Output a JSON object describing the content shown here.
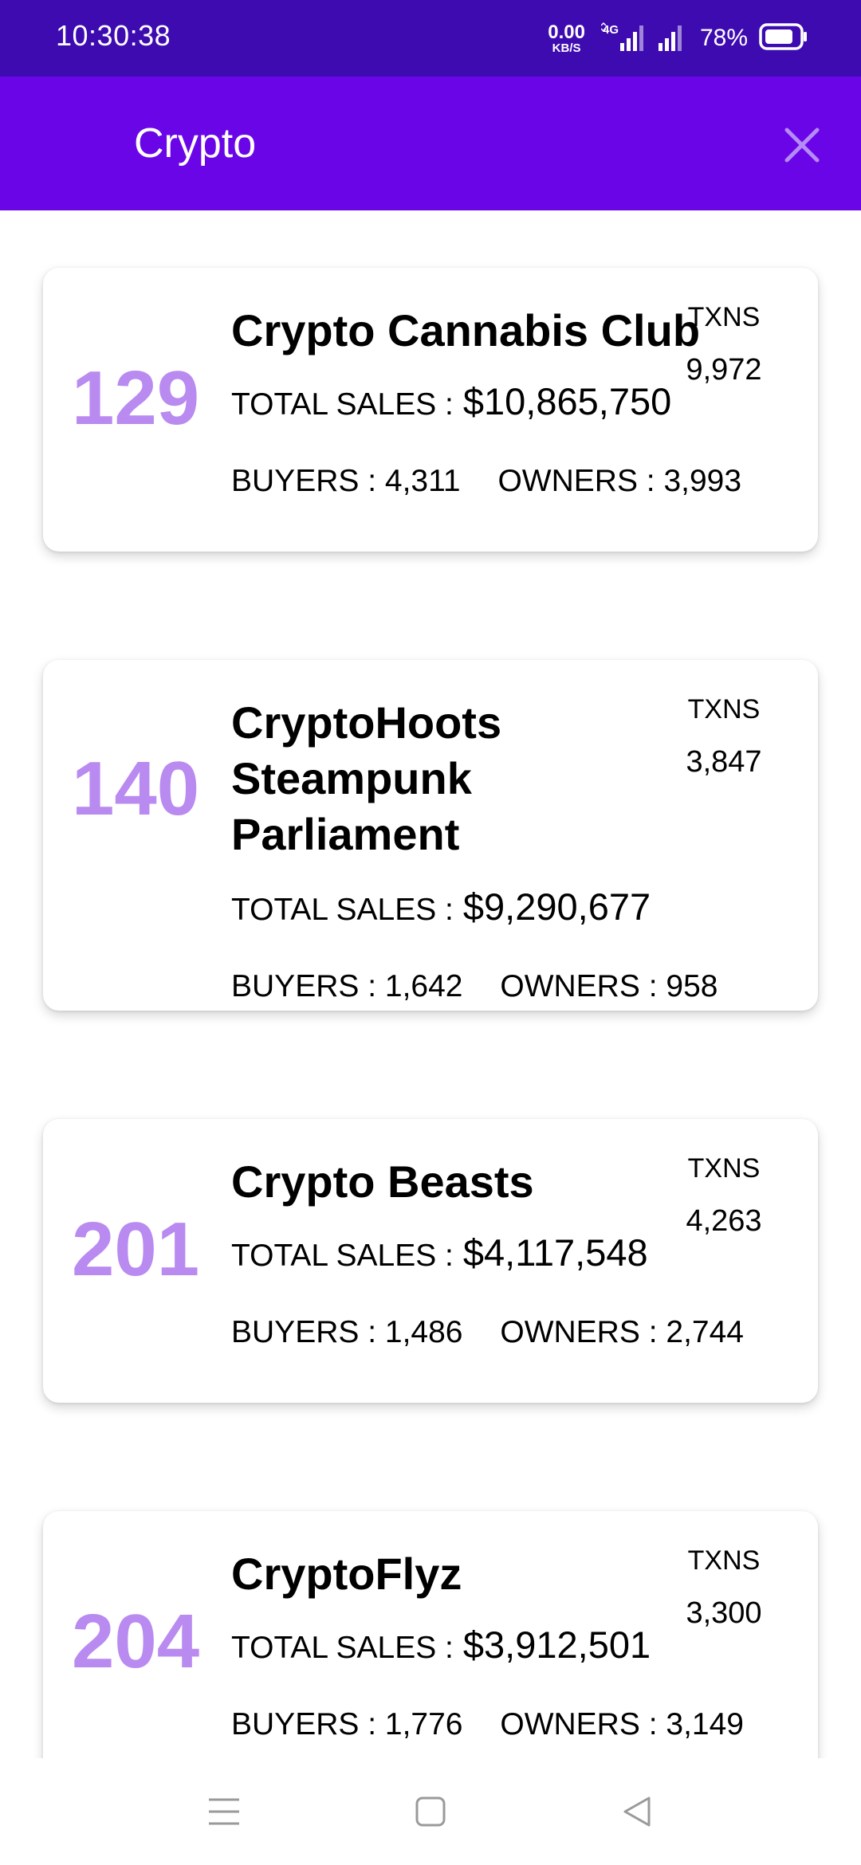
{
  "status_bar": {
    "time": "10:30:38",
    "net_speed_value": "0.00",
    "net_speed_unit": "KB/S",
    "network_type": "4G",
    "battery_percent": "78%",
    "icons": [
      "data-arrows-icon",
      "signal-4g-icon",
      "signal-icon",
      "battery-icon"
    ]
  },
  "app_bar": {
    "title": "Crypto",
    "close_icon": "close-icon"
  },
  "labels": {
    "txns": "TXNS",
    "total_sales": "TOTAL SALES :",
    "buyers": "BUYERS :",
    "owners": "OWNERS :"
  },
  "cards": [
    {
      "rank": "129",
      "name": "Crypto Cannabis Club",
      "txns": "9,972",
      "total_sales": "$10,865,750",
      "buyers": "4,311",
      "owners": "3,993"
    },
    {
      "rank": "140",
      "name": "CryptoHoots Steampunk Parliament",
      "txns": "3,847",
      "total_sales": "$9,290,677",
      "buyers": "1,642",
      "owners": "958"
    },
    {
      "rank": "201",
      "name": "Crypto Beasts",
      "txns": "4,263",
      "total_sales": "$4,117,548",
      "buyers": "1,486",
      "owners": "2,744"
    },
    {
      "rank": "204",
      "name": "CryptoFlyz",
      "txns": "3,300",
      "total_sales": "$3,912,501",
      "buyers": "1,776",
      "owners": "3,149"
    }
  ],
  "nav_bar": {
    "icons": [
      "menu-icon",
      "home-square-icon",
      "back-triangle-icon"
    ]
  },
  "colors": {
    "status_bar": "#3d0bb0",
    "app_bar": "#6a05e8",
    "rank": "#b98af0",
    "close_icon": "#b58cf5"
  }
}
